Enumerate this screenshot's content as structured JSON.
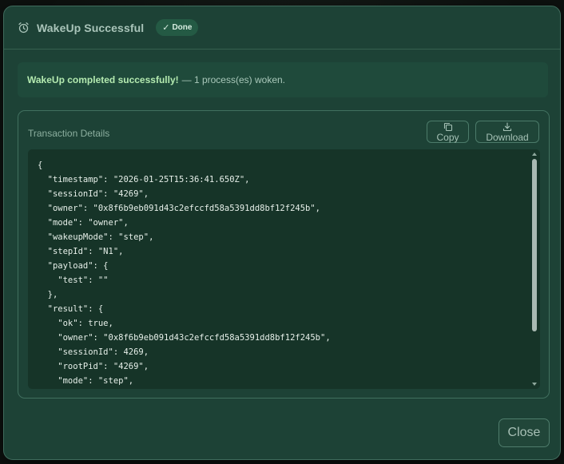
{
  "dialog": {
    "title": "WakeUp Successful",
    "badge": "Done",
    "badge_check": "✓",
    "close_label": "Close"
  },
  "success": {
    "strong": "WakeUp completed successfully!",
    "rest": "— 1 process(es) woken."
  },
  "details": {
    "title": "Transaction Details",
    "copy_label": "Copy",
    "download_label": "Download",
    "code": "{\n  \"timestamp\": \"2026-01-25T15:36:41.650Z\",\n  \"sessionId\": \"4269\",\n  \"owner\": \"0x8f6b9eb091d43c2efccfd58a5391dd8bf12f245b\",\n  \"mode\": \"owner\",\n  \"wakeupMode\": \"step\",\n  \"stepId\": \"N1\",\n  \"payload\": {\n    \"test\": \"\"\n  },\n  \"result\": {\n    \"ok\": true,\n    \"owner\": \"0x8f6b9eb091d43c2efccfd58a5391dd8bf12f245b\",\n    \"sessionId\": 4269,\n    \"rootPid\": \"4269\",\n    \"mode\": \"step\",\n    \"wakeupMode\": \"step\","
  },
  "icons": {
    "title_icon": "alarm-clock-icon",
    "copy_icon": "copy-icon",
    "download_icon": "download-icon"
  },
  "colors": {
    "modal_bg": "#1d4236",
    "success_text": "#b4eab0",
    "badge_bg": "#245a44",
    "code_bg": "#163428"
  }
}
